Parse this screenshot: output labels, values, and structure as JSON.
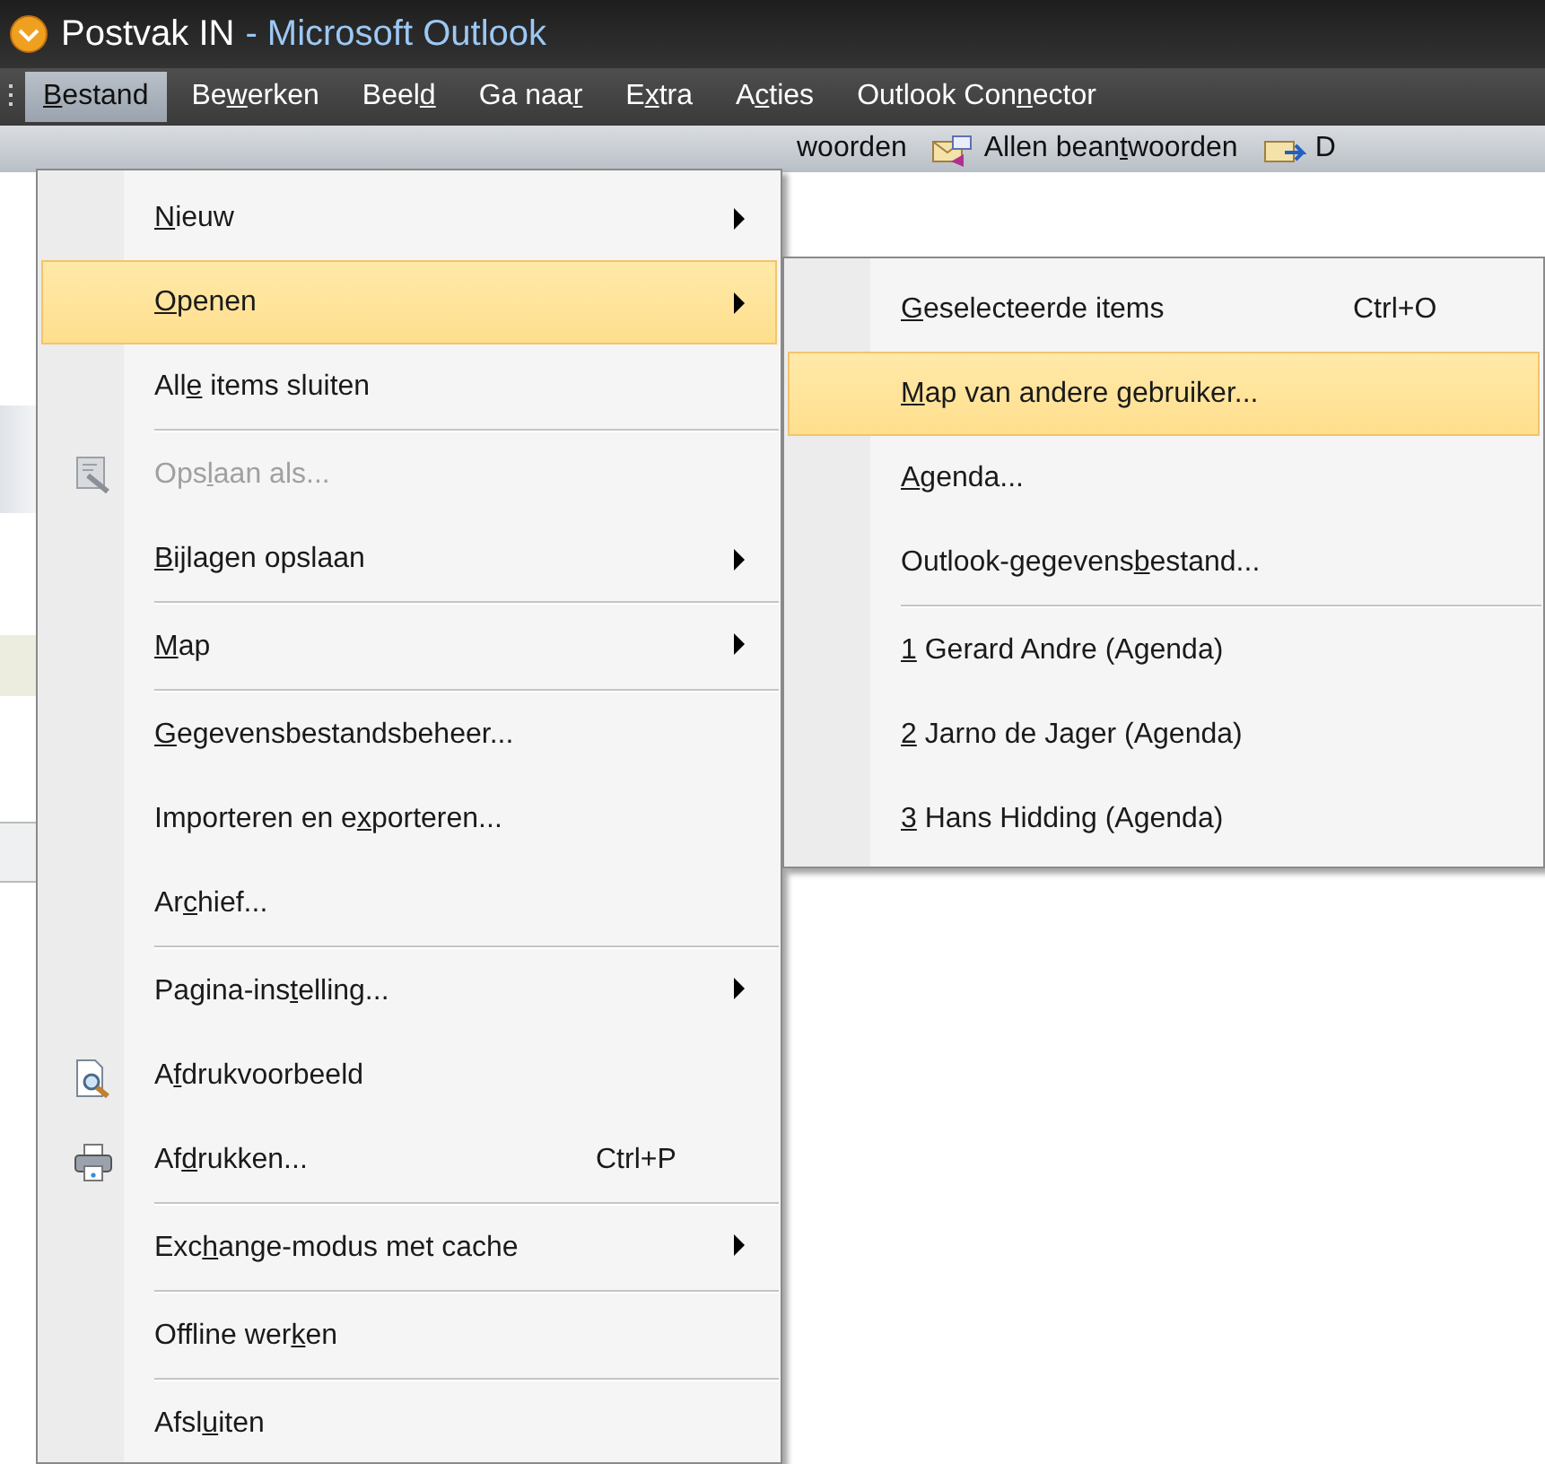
{
  "window": {
    "title": "Postvak IN",
    "app_name": "- Microsoft Outlook"
  },
  "menu_bar": [
    {
      "label": {
        "key": "B",
        "after": "estand"
      },
      "selected": true
    },
    {
      "label": {
        "before": "Be",
        "key": "w",
        "after": "erken"
      },
      "selected": false
    },
    {
      "label": {
        "before": "Beel",
        "key": "d"
      },
      "selected": false
    },
    {
      "label": {
        "before": "Ga naa",
        "key": "r"
      },
      "selected": false
    },
    {
      "label": {
        "before": "E",
        "key": "x",
        "after": "tra"
      },
      "selected": false
    },
    {
      "label": {
        "before": "A",
        "key": "c",
        "after": "ties"
      },
      "selected": false
    },
    {
      "label": {
        "before": "Outlook Con",
        "key": "n",
        "after": "ector"
      },
      "selected": false
    }
  ],
  "toolbar": [
    {
      "label": {
        "before": "woorden"
      }
    },
    {
      "label": {
        "before": "Allen bean",
        "key": "t",
        "after": "woorden"
      }
    },
    {
      "label": {
        "before": "D"
      }
    }
  ],
  "file_menu": [
    {
      "label": {
        "key": "N",
        "after": "ieuw"
      },
      "submenu": true,
      "selected": false,
      "disabled": false,
      "separator_before": false
    },
    {
      "label": {
        "key": "O",
        "after": "penen"
      },
      "submenu": true,
      "selected": true,
      "disabled": false,
      "separator_before": false
    },
    {
      "label": {
        "before": "All",
        "key": "e",
        "after": " items sluiten"
      },
      "submenu": false,
      "selected": false,
      "disabled": false,
      "separator_before": false
    },
    {
      "label": {
        "before": "Ops",
        "key": "l",
        "after": "aan als..."
      },
      "submenu": false,
      "selected": false,
      "disabled": true,
      "separator_before": true
    },
    {
      "label": {
        "key": "B",
        "after": "ijlagen opslaan"
      },
      "submenu": true,
      "selected": false,
      "disabled": false,
      "separator_before": false
    },
    {
      "label": {
        "key": "M",
        "after": "ap"
      },
      "submenu": true,
      "selected": false,
      "disabled": false,
      "separator_before": true
    },
    {
      "label": {
        "key": "G",
        "after": "egevensbestandsbeheer..."
      },
      "submenu": false,
      "selected": false,
      "disabled": false,
      "separator_before": true
    },
    {
      "label": {
        "before": "Importeren en e",
        "key": "x",
        "after": "porteren..."
      },
      "submenu": false,
      "selected": false,
      "disabled": false,
      "separator_before": false
    },
    {
      "label": {
        "before": "Ar",
        "key": "c",
        "after": "hief..."
      },
      "submenu": false,
      "selected": false,
      "disabled": false,
      "separator_before": false
    },
    {
      "label": {
        "before": "Pagina-ins",
        "key": "t",
        "after": "elling..."
      },
      "submenu": true,
      "selected": false,
      "disabled": false,
      "separator_before": true
    },
    {
      "label": {
        "before": "A",
        "key": "f",
        "after": "drukvoorbeeld"
      },
      "submenu": false,
      "selected": false,
      "disabled": false,
      "separator_before": false
    },
    {
      "label": {
        "before": "Af",
        "key": "d",
        "after": "rukken..."
      },
      "shortcut": "Ctrl+P",
      "submenu": false,
      "selected": false,
      "disabled": false,
      "separator_before": false
    },
    {
      "label": {
        "before": "Exc",
        "key": "h",
        "after": "ange-modus met cache"
      },
      "submenu": true,
      "selected": false,
      "disabled": false,
      "separator_before": true
    },
    {
      "label": {
        "before": "Offline wer",
        "key": "k",
        "after": "en"
      },
      "submenu": false,
      "selected": false,
      "disabled": false,
      "separator_before": true
    },
    {
      "label": {
        "before": "Afsl",
        "key": "u",
        "after": "iten"
      },
      "submenu": false,
      "selected": false,
      "disabled": false,
      "separator_before": true
    }
  ],
  "open_submenu": [
    {
      "label": {
        "key": "G",
        "after": "eselecteerde items"
      },
      "shortcut": "Ctrl+O",
      "selected": false,
      "separator_before": false
    },
    {
      "label": {
        "key": "M",
        "after": "ap van andere gebruiker..."
      },
      "selected": true,
      "separator_before": false
    },
    {
      "label": {
        "key": "A",
        "after": "genda..."
      },
      "selected": false,
      "separator_before": false
    },
    {
      "label": {
        "before": "Outlook-gegevens",
        "key": "b",
        "after": "estand..."
      },
      "selected": false,
      "separator_before": false
    },
    {
      "label": {
        "key": "1",
        "after": " Gerard Andre (Agenda)"
      },
      "selected": false,
      "separator_before": true
    },
    {
      "label": {
        "key": "2",
        "after": " Jarno de Jager (Agenda)"
      },
      "selected": false,
      "separator_before": false
    },
    {
      "label": {
        "key": "3",
        "after": " Hans Hidding (Agenda)"
      },
      "selected": false,
      "separator_before": false
    }
  ]
}
